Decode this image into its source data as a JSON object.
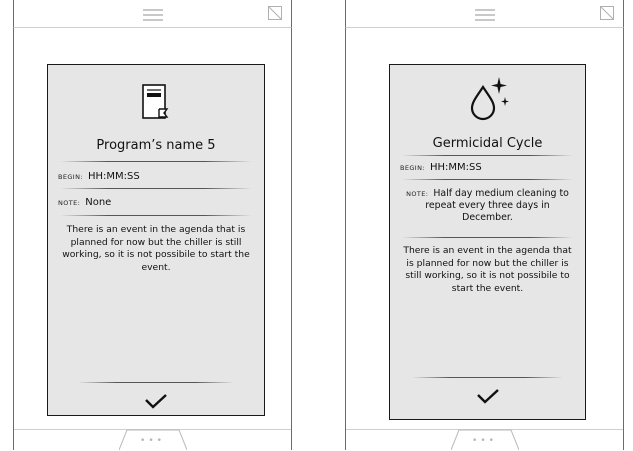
{
  "left_screen": {
    "title": "Program’s name 5",
    "begin_label": "BEGIN:",
    "begin_value": "HH:MM:SS",
    "note_label": "NOTE:",
    "note_value": "None",
    "message": "There is an event in the agenda that is planned for now but the chiller is still working, so it is not possibile to start the event.",
    "icon": "program-document-icon",
    "confirm_icon": "checkmark-icon",
    "footer_dots": "•••"
  },
  "right_screen": {
    "title": "Germicidal Cycle",
    "begin_label": "BEGIN:",
    "begin_value": "HH:MM:SS",
    "note_label": "NOTE:",
    "note_value": "Half day medium cleaning to repeat every three days in December.",
    "message": "There is an event in the agenda that is planned for now but the chiller is still working, so it is not possibile to start the event.",
    "icon": "drop-sparkle-icon",
    "confirm_icon": "checkmark-icon",
    "footer_dots": "•••"
  },
  "colors": {
    "card_background": "#e6e6e6",
    "frame": "#1a1a1a",
    "divider": "#cfcfcf"
  }
}
